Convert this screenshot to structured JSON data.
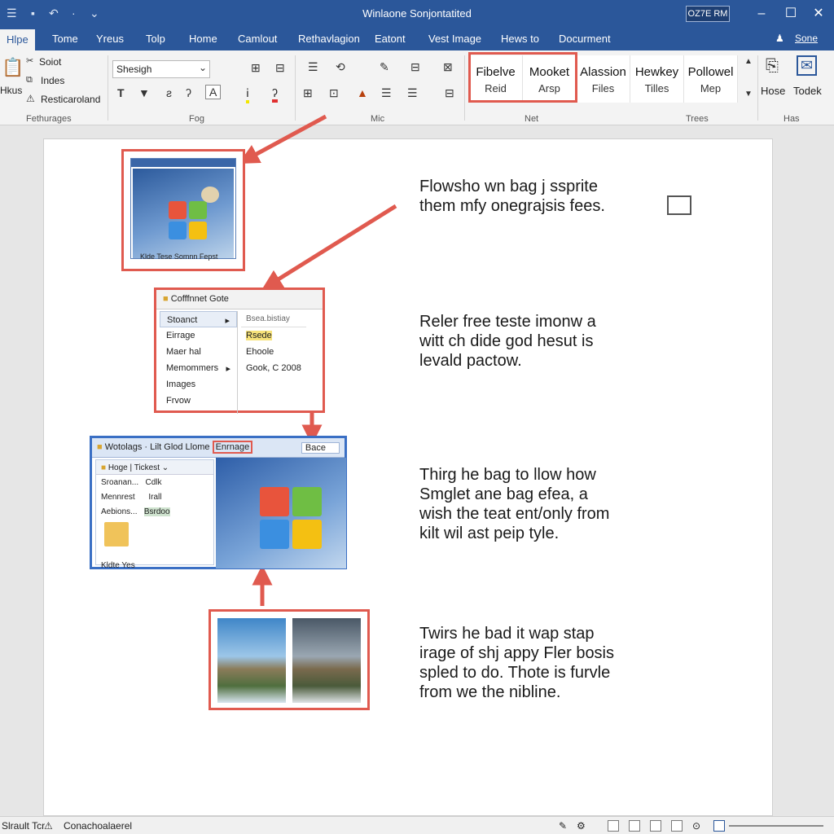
{
  "window": {
    "title": "Winlaone Sonjontatited",
    "badge": "OZ7E RM",
    "minimize": "–",
    "maximize": "☐",
    "close": "✕"
  },
  "tabs": [
    "Hlpe",
    "Tome",
    "Yreus",
    "Tolp",
    "Home",
    "Camlout",
    "Rethavlagion",
    "Eatont",
    "Vest Image",
    "Hews to",
    "Docurment"
  ],
  "tabs_right": {
    "user": "Sone"
  },
  "ribbon": {
    "clipboard": {
      "paste": "Hkus",
      "items": [
        "Soiot",
        "Indes",
        "Resticaroland"
      ],
      "group": "Fethurages"
    },
    "font": {
      "name": "Shesigh",
      "group": "Fog"
    },
    "paragraph": {
      "group": "Mic"
    },
    "styles": {
      "tiles": [
        {
          "a": "Fibelve",
          "b": "Reid"
        },
        {
          "a": "Mooket",
          "b": "Arsp"
        },
        {
          "a": "Alassion",
          "b": "Files"
        },
        {
          "a": "Hewkey",
          "b": "Tilles"
        },
        {
          "a": "Pollowel",
          "b": "Mep"
        }
      ],
      "group_net": "Net",
      "group_trees": "Trees"
    },
    "editing": {
      "hose": "Hose",
      "todek": "Todek",
      "group": "Has"
    }
  },
  "document": {
    "blocks": [
      {
        "lines": [
          "Flowsho wn bag j ssprite",
          "them mfy onegrajsis fees."
        ]
      },
      {
        "lines": [
          "Reler free teste imonw a",
          "witt ch dide god hesut is",
          "levald pactow."
        ]
      },
      {
        "lines": [
          "Thirg he bag to llow how",
          "Smglet ane bag efea, a",
          "wish the teat ent/only from",
          "kilt wil ast peip tyle."
        ]
      },
      {
        "lines": [
          "Twirs he bad it wap stap",
          "irage of shj appy Fler bosis",
          "spled to do. Thote is furvle",
          "from we the nibline."
        ]
      }
    ],
    "thumb1_caption": "Klde Tese Somnn Fepst",
    "menu": {
      "title": "Cofffnnet Gote",
      "left": [
        "Stoanct",
        "Eirrage",
        "Maer hal",
        "Memommers",
        "Images",
        "Frvow"
      ],
      "right_header": "Bsea.bistiay",
      "right": [
        "Rsede",
        "Ehoole",
        "Gook, C 2008"
      ]
    },
    "explorer": {
      "title": "Wotolags · Lilt Glod Llome",
      "highlight": "Enrnage",
      "search": "Bace",
      "nav_header": [
        "Hoge",
        "Tickest"
      ],
      "nav_items": [
        "Sroanan...",
        "Mennrest",
        "Aebions..."
      ],
      "nav_right": [
        "Cdlk",
        "Irall",
        "Bsrdoo"
      ],
      "folder_caption": "Kldte Yes"
    }
  },
  "status": {
    "left": "Slrault Tcr",
    "doc": "Conachoalaerel"
  },
  "colors": {
    "accent": "#2b579a",
    "annotation": "#e05a4f"
  }
}
